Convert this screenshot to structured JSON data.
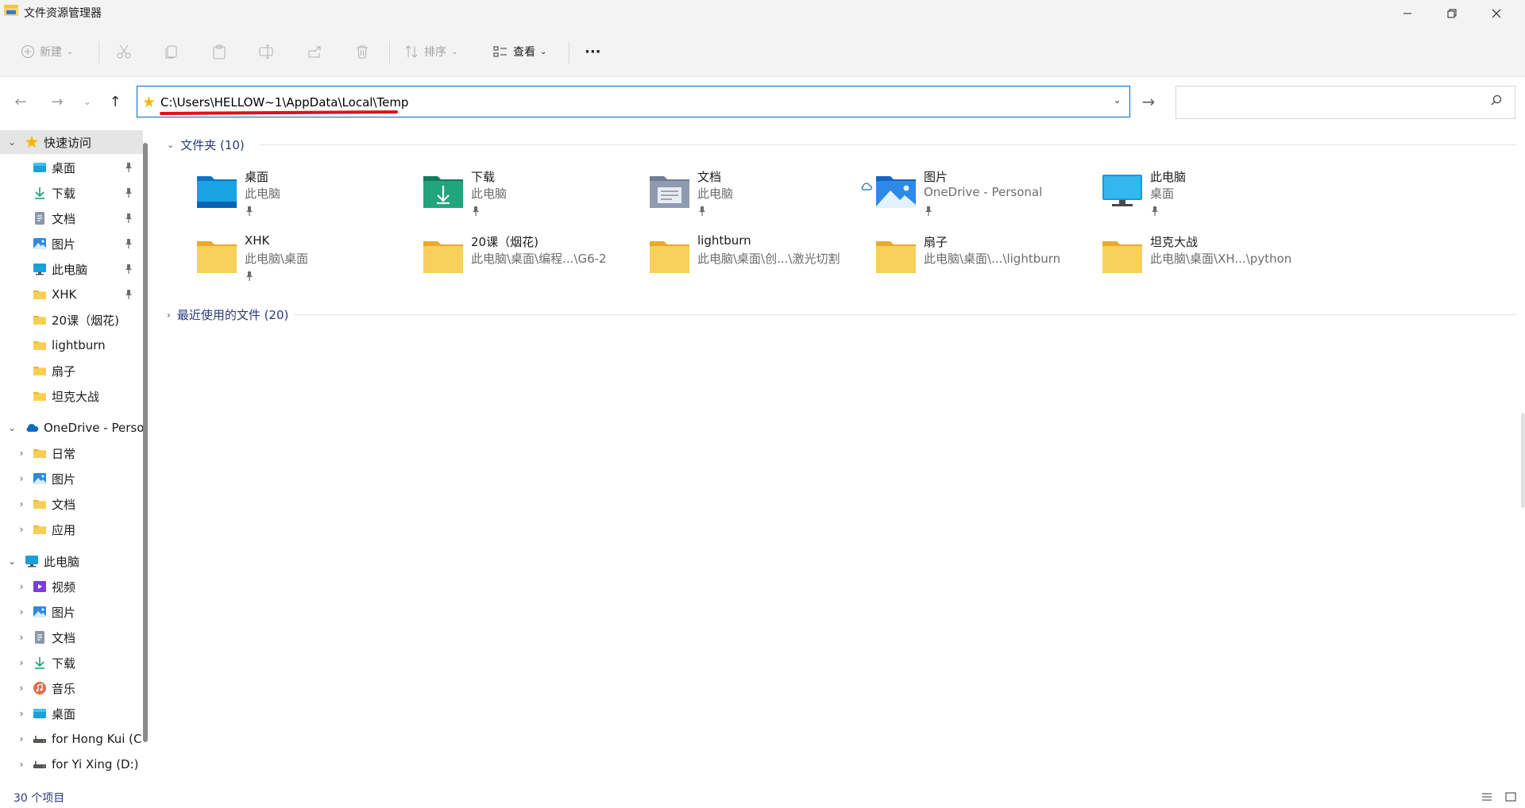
{
  "window": {
    "title": "文件资源管理器"
  },
  "toolbar": {
    "new_label": "新建",
    "sort_label": "排序",
    "view_label": "查看",
    "more_label": "···"
  },
  "address": {
    "path": "C:\\Users\\HELLOW~1\\AppData\\Local\\Temp",
    "search_value": ""
  },
  "sidebar": {
    "quick_access": {
      "label": "快速访问",
      "items": [
        {
          "label": "桌面",
          "icon": "desktop-icon",
          "pinned": true
        },
        {
          "label": "下载",
          "icon": "download-icon",
          "pinned": true
        },
        {
          "label": "文档",
          "icon": "document-icon",
          "pinned": true
        },
        {
          "label": "图片",
          "icon": "pictures-icon",
          "pinned": true
        },
        {
          "label": "此电脑",
          "icon": "computer-icon",
          "pinned": true
        },
        {
          "label": "XHK",
          "icon": "folder-icon",
          "pinned": true
        },
        {
          "label": "20课（烟花)",
          "icon": "folder-icon",
          "pinned": false
        },
        {
          "label": "lightburn",
          "icon": "folder-icon",
          "pinned": false
        },
        {
          "label": "扇子",
          "icon": "folder-icon",
          "pinned": false
        },
        {
          "label": "坦克大战",
          "icon": "folder-icon",
          "pinned": false
        }
      ]
    },
    "onedrive": {
      "label": "OneDrive - Personal",
      "items": [
        {
          "label": "日常",
          "icon": "folder-icon"
        },
        {
          "label": "图片",
          "icon": "pictures-icon"
        },
        {
          "label": "文档",
          "icon": "folder-icon"
        },
        {
          "label": "应用",
          "icon": "folder-icon"
        }
      ]
    },
    "this_pc": {
      "label": "此电脑",
      "items": [
        {
          "label": "视频",
          "icon": "video-icon"
        },
        {
          "label": "图片",
          "icon": "pictures-icon"
        },
        {
          "label": "文档",
          "icon": "document-icon"
        },
        {
          "label": "下载",
          "icon": "download-icon"
        },
        {
          "label": "音乐",
          "icon": "music-icon"
        },
        {
          "label": "桌面",
          "icon": "desktop-icon"
        },
        {
          "label": "for Hong Kui (C:)",
          "icon": "drive-icon"
        },
        {
          "label": "for Yi Xing (D:)",
          "icon": "drive-icon"
        }
      ]
    }
  },
  "main": {
    "folders_header": "文件夹 (10)",
    "recent_header": "最近使用的文件 (20)",
    "folders": [
      {
        "name": "桌面",
        "sub": "此电脑",
        "icon": "desktop-folder-icon",
        "pinned": true
      },
      {
        "name": "下载",
        "sub": "此电脑",
        "icon": "download-folder-icon",
        "pinned": true
      },
      {
        "name": "文档",
        "sub": "此电脑",
        "icon": "document-folder-icon",
        "pinned": true
      },
      {
        "name": "图片",
        "sub": "OneDrive - Personal",
        "icon": "pictures-folder-icon",
        "pinned": true
      },
      {
        "name": "此电脑",
        "sub": "桌面",
        "icon": "computer-icon",
        "pinned": true
      },
      {
        "name": "XHK",
        "sub": "此电脑\\桌面",
        "icon": "folder-icon",
        "pinned": true
      },
      {
        "name": "20课（烟花)",
        "sub": "此电脑\\桌面\\编程...\\G6-2",
        "icon": "folder-icon",
        "pinned": false
      },
      {
        "name": "lightburn",
        "sub": "此电脑\\桌面\\创...\\激光切割",
        "icon": "folder-icon",
        "pinned": false
      },
      {
        "name": "扇子",
        "sub": "此电脑\\桌面\\...\\lightburn",
        "icon": "folder-icon",
        "pinned": false
      },
      {
        "name": "坦克大战",
        "sub": "此电脑\\桌面\\XH...\\python",
        "icon": "folder-icon",
        "pinned": false
      }
    ]
  },
  "status": {
    "item_count": "30 个项目"
  },
  "colors": {
    "accent": "#0067c0",
    "folder": "#f8c94a",
    "annotation": "#e0101a"
  }
}
